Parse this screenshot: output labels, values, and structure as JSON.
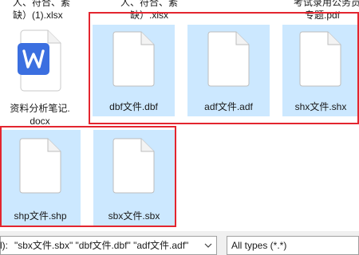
{
  "top_labels": {
    "left": "人、符合、紊",
    "left_line2": "缺）(1).xlsx",
    "middle": "人、符合、紊",
    "middle_line2": "缺）.xlsx",
    "right": "考试录用公务员",
    "right_line2": "专题.pdf"
  },
  "files": {
    "docx": {
      "name_line1": "资料分析笔记.",
      "name_line2": "docx",
      "icon": "word-icon"
    },
    "dbf": {
      "name": "dbf文件.dbf",
      "icon": "blank-file-icon"
    },
    "adf": {
      "name": "adf文件.adf",
      "icon": "blank-file-icon"
    },
    "shx": {
      "name": "shx文件.shx",
      "icon": "blank-file-icon"
    },
    "shp": {
      "name": "shp文件.shp",
      "icon": "blank-file-icon"
    },
    "sbx": {
      "name": "sbx文件.sbx",
      "icon": "blank-file-icon"
    }
  },
  "footer": {
    "filename_prefix": "l):",
    "filename_value": "\"sbx文件.sbx\" \"dbf文件.dbf\" \"adf文件.adf\"",
    "filetype_value": "All types (*.*)"
  },
  "colors": {
    "selection": "#cce8ff",
    "highlight_border": "#e3252f",
    "word_blue": "#3b6fe0"
  }
}
